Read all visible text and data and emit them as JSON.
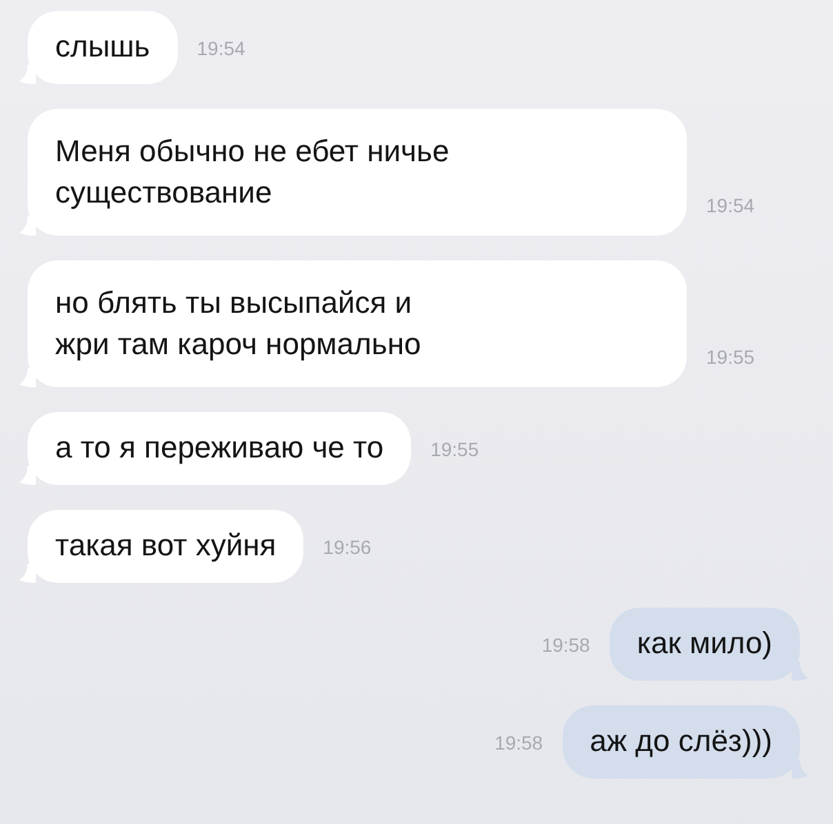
{
  "messages": [
    {
      "kind": "in",
      "lines": [
        "слышь"
      ],
      "time": "19:54"
    },
    {
      "kind": "in",
      "lines": [
        "Меня обычно не ебет ничье",
        "существование"
      ],
      "time": "19:54"
    },
    {
      "kind": "in",
      "lines": [
        "но блять ты высыпайся и",
        "жри там кароч нормально"
      ],
      "time": "19:55"
    },
    {
      "kind": "in",
      "lines": [
        "а то я переживаю че то"
      ],
      "time": "19:55"
    },
    {
      "kind": "in",
      "lines": [
        "такая вот хуйня"
      ],
      "time": "19:56"
    },
    {
      "kind": "out",
      "lines": [
        "как мило)"
      ],
      "time": "19:58"
    },
    {
      "kind": "out",
      "lines": [
        "аж до слёз)))"
      ],
      "time": "19:58"
    }
  ]
}
